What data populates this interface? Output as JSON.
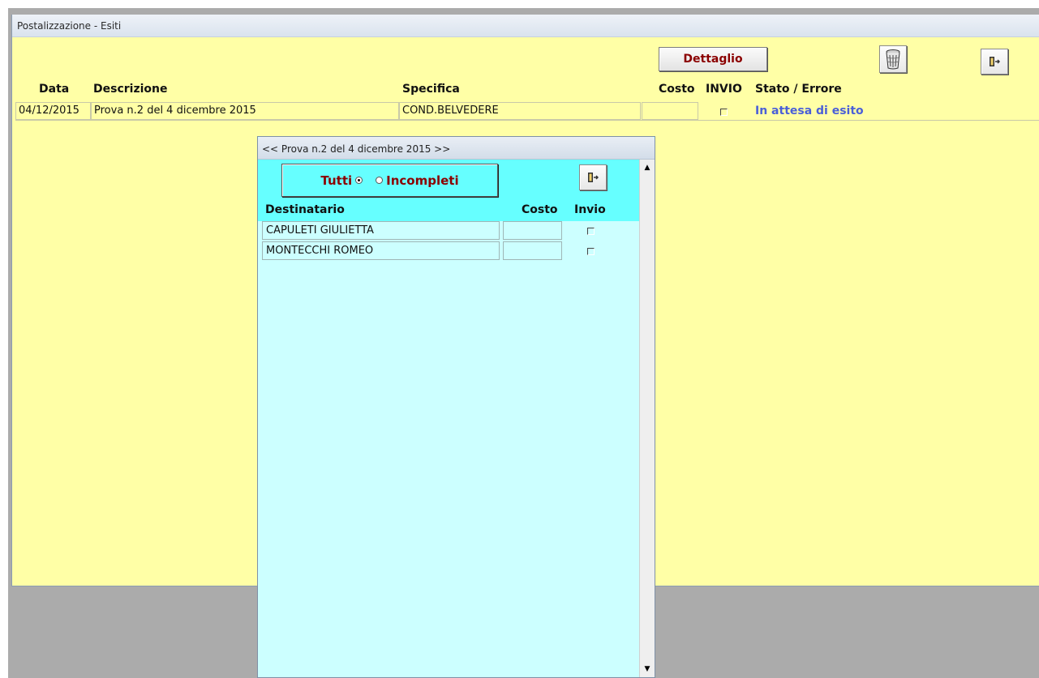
{
  "main": {
    "title": "Postalizzazione - Esiti",
    "dettaglio_label": "Dettaglio",
    "headers": {
      "data": "Data",
      "descrizione": "Descrizione",
      "specifica": "Specifica",
      "costo": "Costo",
      "invio": "INVIO",
      "stato": "Stato / Errore"
    },
    "row": {
      "data": "04/12/2015",
      "descrizione": "Prova n.2 del 4 dicembre 2015",
      "specifica": "COND.BELVEDERE",
      "costo": "",
      "invio_checked": false,
      "stato": "In attesa di esito"
    }
  },
  "popup": {
    "title": "<< Prova n.2 del 4 dicembre 2015 >>",
    "filter": {
      "tutti": "Tutti",
      "incompleti": "Incompleti",
      "selected": "Tutti"
    },
    "headers": {
      "destinatario": "Destinatario",
      "costo": "Costo",
      "invio": "Invio"
    },
    "rows": [
      {
        "destinatario": "CAPULETI GIULIETTA",
        "costo": "",
        "invio_checked": false
      },
      {
        "destinatario": "MONTECCHI ROMEO",
        "costo": "",
        "invio_checked": false
      }
    ]
  },
  "colors": {
    "main_bg": "#ffffa6",
    "popup_bg": "#ccffff",
    "popup_header_bg": "#66ffff",
    "accent_text": "#8b0000",
    "status_blue": "#4a5fd8"
  },
  "icons": {
    "trash": "trash-icon",
    "exit": "exit-door-icon"
  }
}
